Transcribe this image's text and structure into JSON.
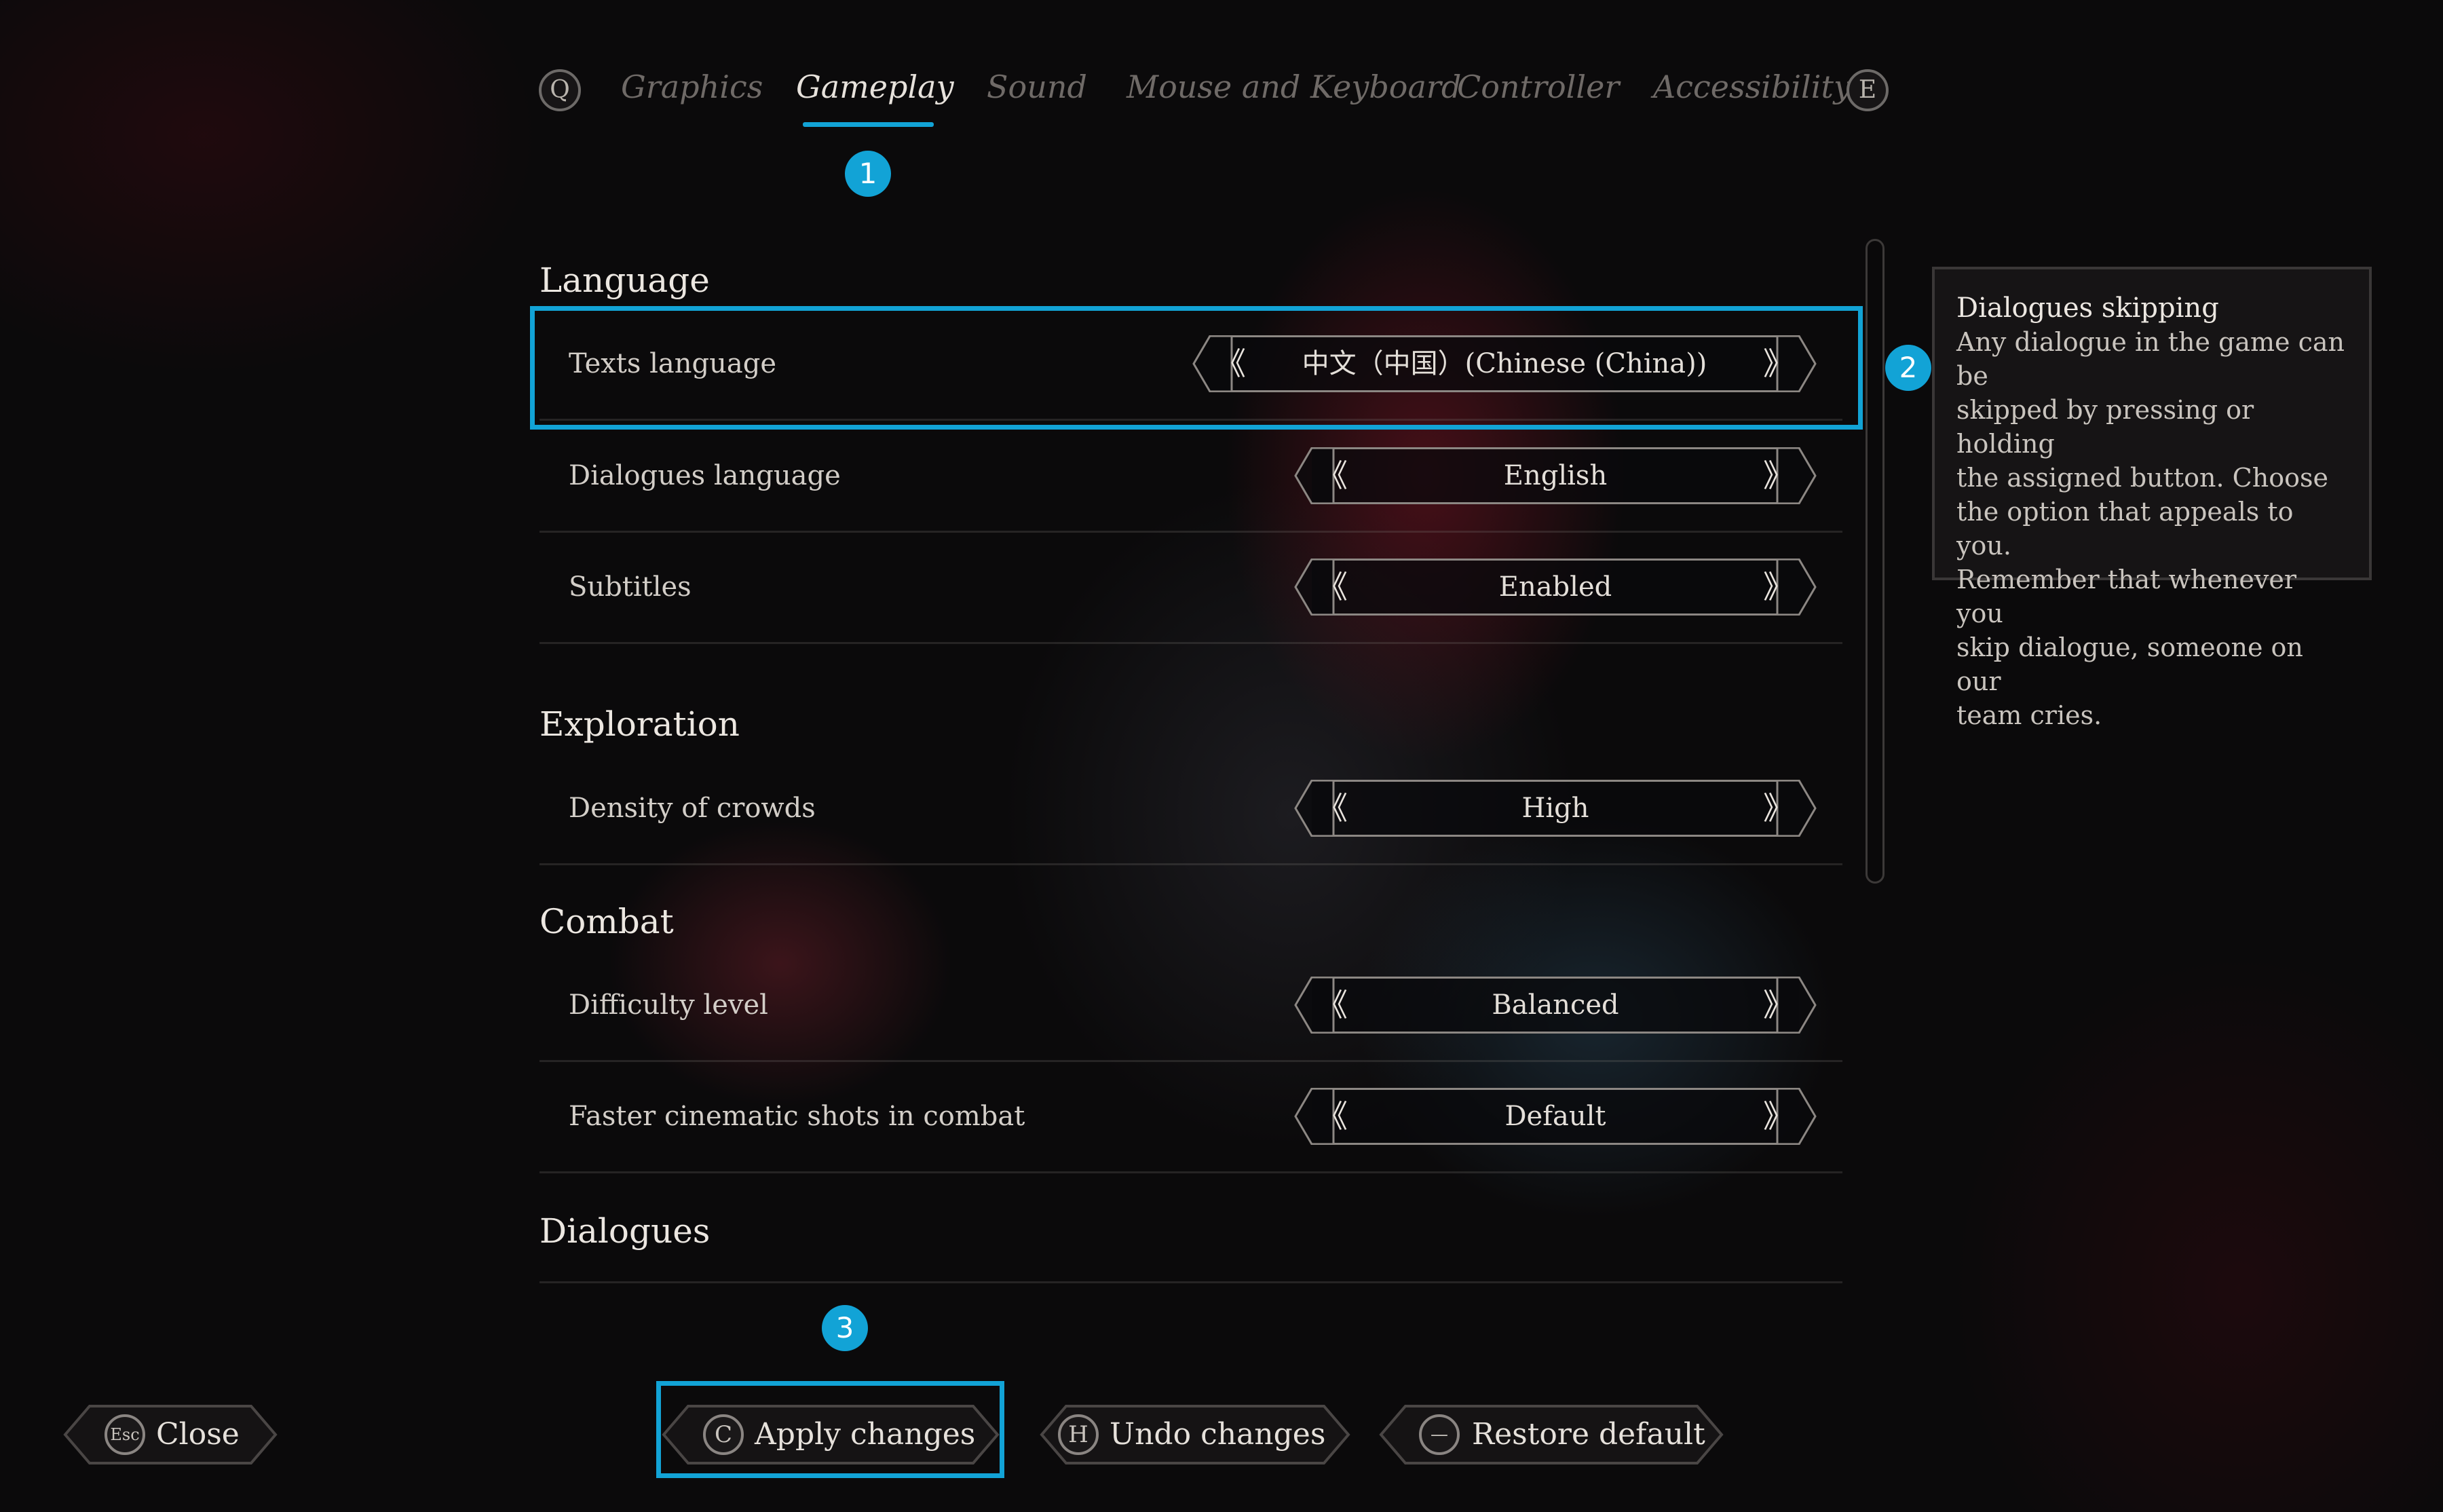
{
  "tabs": {
    "prev_key": "Q",
    "next_key": "E",
    "items": [
      {
        "label": "Graphics"
      },
      {
        "label": "Gameplay"
      },
      {
        "label": "Sound"
      },
      {
        "label": "Mouse and Keyboard"
      },
      {
        "label": "Controller"
      },
      {
        "label": "Accessibility"
      }
    ],
    "active": "Gameplay"
  },
  "badges": [
    "1",
    "2",
    "3"
  ],
  "sections": [
    {
      "title": "Language",
      "rows": [
        {
          "label": "Texts language",
          "value": "中文（中国）(Chinese (China))"
        },
        {
          "label": "Dialogues language",
          "value": "English"
        },
        {
          "label": "Subtitles",
          "value": "Enabled"
        }
      ]
    },
    {
      "title": "Exploration",
      "rows": [
        {
          "label": "Density of crowds",
          "value": "High"
        }
      ]
    },
    {
      "title": "Combat",
      "rows": [
        {
          "label": "Difficulty level",
          "value": "Balanced"
        },
        {
          "label": "Faster cinematic shots in combat",
          "value": "Default"
        }
      ]
    },
    {
      "title": "Dialogues",
      "rows": []
    }
  ],
  "selector_arrows": {
    "left": "《",
    "right": "》"
  },
  "tooltip": {
    "title": "Dialogues skipping",
    "lines": [
      "Any dialogue in the game can be",
      "skipped by pressing or holding",
      "the assigned button. Choose",
      "the option that appeals to you.",
      "Remember that whenever you",
      "skip dialogue, someone on our",
      "team cries."
    ]
  },
  "footer": {
    "close": {
      "key": "Esc",
      "label": "Close"
    },
    "apply": {
      "key": "C",
      "label": "Apply changes"
    },
    "undo": {
      "key": "H",
      "label": "Undo changes"
    },
    "restore": {
      "key": "—",
      "label": "Restore default"
    }
  },
  "colors": {
    "accent": "#12a3d6",
    "text": "#d8d4cf",
    "inactive_tab": "#6f6a67"
  }
}
